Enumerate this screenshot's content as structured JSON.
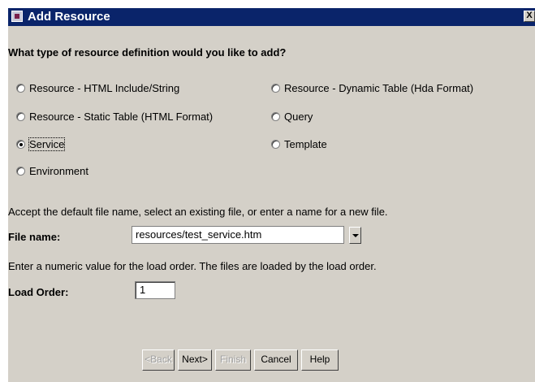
{
  "dialog": {
    "title": "Add Resource",
    "close_label": "X"
  },
  "question": "What type of resource definition would you like to add?",
  "options": [
    {
      "label": "Resource - HTML Include/String",
      "selected": false
    },
    {
      "label": "Resource - Dynamic Table (Hda Format)",
      "selected": false
    },
    {
      "label": "Resource - Static Table (HTML Format)",
      "selected": false
    },
    {
      "label": "Query",
      "selected": false
    },
    {
      "label": "Service",
      "selected": true
    },
    {
      "label": "Template",
      "selected": false
    },
    {
      "label": "Environment",
      "selected": false
    }
  ],
  "file_instructions": "Accept the default file name, select an existing file, or enter a name for a new file.",
  "file_name": {
    "label": "File name:",
    "value": "resources/test_service.htm"
  },
  "load_instructions": "Enter a numeric value for the load order. The files are loaded by the load order.",
  "load_order": {
    "label": "Load Order:",
    "value": "1"
  },
  "buttons": {
    "back": "<Back",
    "next": "Next>",
    "finish": "Finish",
    "cancel": "Cancel",
    "help": "Help"
  }
}
